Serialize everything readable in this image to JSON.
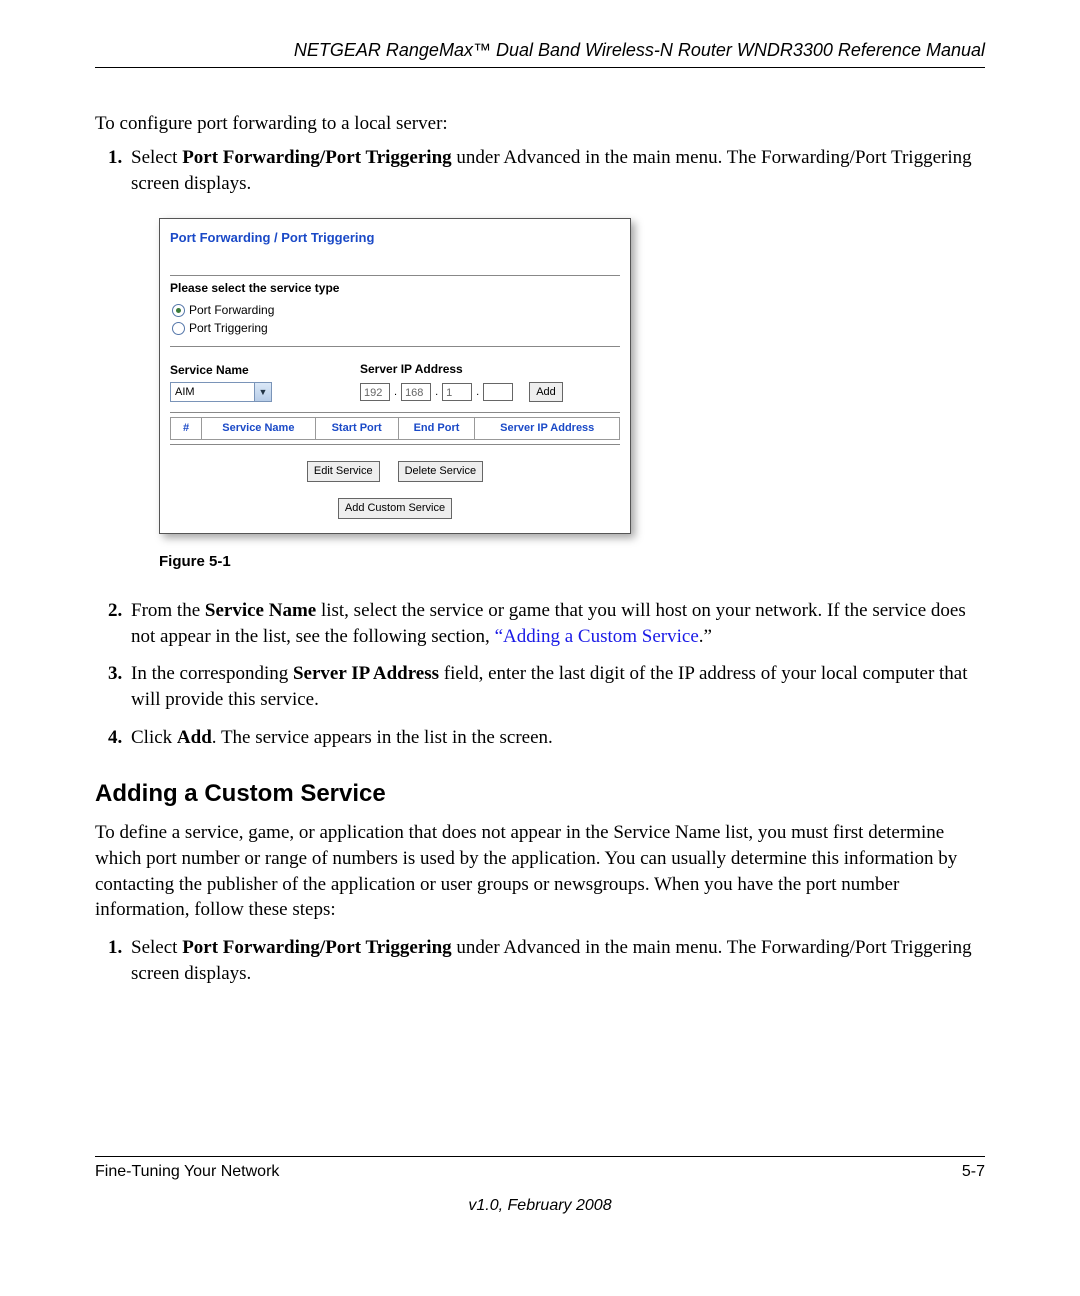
{
  "header": "NETGEAR RangeMax™ Dual Band Wireless-N Router WNDR3300 Reference Manual",
  "intro": "To configure port forwarding to a local server:",
  "steps1": {
    "s1a": "Select ",
    "s1b": "Port Forwarding/Port Triggering",
    "s1c": " under Advanced in the main menu. The Forwarding/Port Triggering screen displays."
  },
  "screenshot": {
    "title": "Port Forwarding / Port Triggering",
    "select_type_label": "Please select the service type",
    "radio_forwarding": "Port Forwarding",
    "radio_triggering": "Port Triggering",
    "service_name_label": "Service Name",
    "server_ip_label": "Server IP Address",
    "service_selected": "AIM",
    "ip": {
      "o1": "192",
      "o2": "168",
      "o3": "1",
      "o4": ""
    },
    "add_btn": "Add",
    "table": {
      "num": "#",
      "service": "Service Name",
      "start": "Start Port",
      "end": "End Port",
      "server": "Server IP Address"
    },
    "edit_btn": "Edit Service",
    "delete_btn": "Delete Service",
    "custom_btn": "Add Custom Service"
  },
  "figure_caption": "Figure 5-1",
  "steps2": {
    "s2a": "From the ",
    "s2b": "Service Name",
    "s2c": " list, select the service or game that you will host on your network. If the service does not appear in the list, see the following section, ",
    "s2link": "“Adding a Custom Service",
    "s2d": ".”",
    "s3a": "In the corresponding ",
    "s3b": "Server IP Address",
    "s3c": " field, enter the last digit of the IP address of your local computer that will provide this service.",
    "s4a": "Click ",
    "s4b": "Add",
    "s4c": ". The service appears in the list in the screen."
  },
  "section_heading": "Adding a Custom Service",
  "section_body": "To define a service, game, or application that does not appear in the Service Name list, you must first determine which port number or range of numbers is used by the application. You can usually determine this information by contacting the publisher of the application or user groups or newsgroups. When you have the port number information, follow these steps:",
  "steps3": {
    "s1a": "Select ",
    "s1b": "Port Forwarding/Port Triggering",
    "s1c": " under Advanced in the main menu. The Forwarding/Port Triggering screen displays."
  },
  "footer": {
    "left": "Fine-Tuning Your Network",
    "right": "5-7"
  },
  "version": "v1.0, February 2008"
}
